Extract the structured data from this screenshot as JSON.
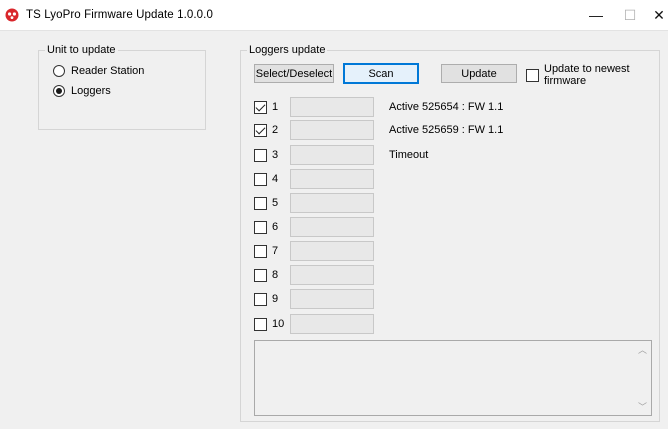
{
  "window": {
    "title": "TS LyoPro Firmware Update 1.0.0.0",
    "minimize_glyph": "—",
    "maximize_glyph": "☐",
    "close_glyph": "✕"
  },
  "unit_group": {
    "legend": "Unit to update",
    "options": [
      {
        "label": "Reader Station",
        "selected": false
      },
      {
        "label": "Loggers",
        "selected": true
      }
    ]
  },
  "loggers_group": {
    "legend": "Loggers update",
    "select_deselect_label": "Select/Deselect",
    "scan_label": "Scan",
    "update_label": "Update",
    "update_newest_label": "Update to newest firmware",
    "update_newest_checked": false,
    "loggers": [
      {
        "num": "1",
        "checked": true,
        "value": "",
        "status": "Active 525654 : FW 1.1"
      },
      {
        "num": "2",
        "checked": true,
        "value": "",
        "status": "Active 525659 : FW 1.1"
      },
      {
        "num": "3",
        "checked": false,
        "value": "",
        "status": "Timeout"
      },
      {
        "num": "4",
        "checked": false,
        "value": "",
        "status": ""
      },
      {
        "num": "5",
        "checked": false,
        "value": "",
        "status": ""
      },
      {
        "num": "6",
        "checked": false,
        "value": "",
        "status": ""
      },
      {
        "num": "7",
        "checked": false,
        "value": "",
        "status": ""
      },
      {
        "num": "8",
        "checked": false,
        "value": "",
        "status": ""
      },
      {
        "num": "9",
        "checked": false,
        "value": "",
        "status": ""
      },
      {
        "num": "10",
        "checked": false,
        "value": "",
        "status": ""
      }
    ],
    "log_text": ""
  },
  "colors": {
    "window_bg": "#f0f0f0",
    "accent_blue": "#0078d7",
    "app_icon_red": "#d9262b"
  }
}
